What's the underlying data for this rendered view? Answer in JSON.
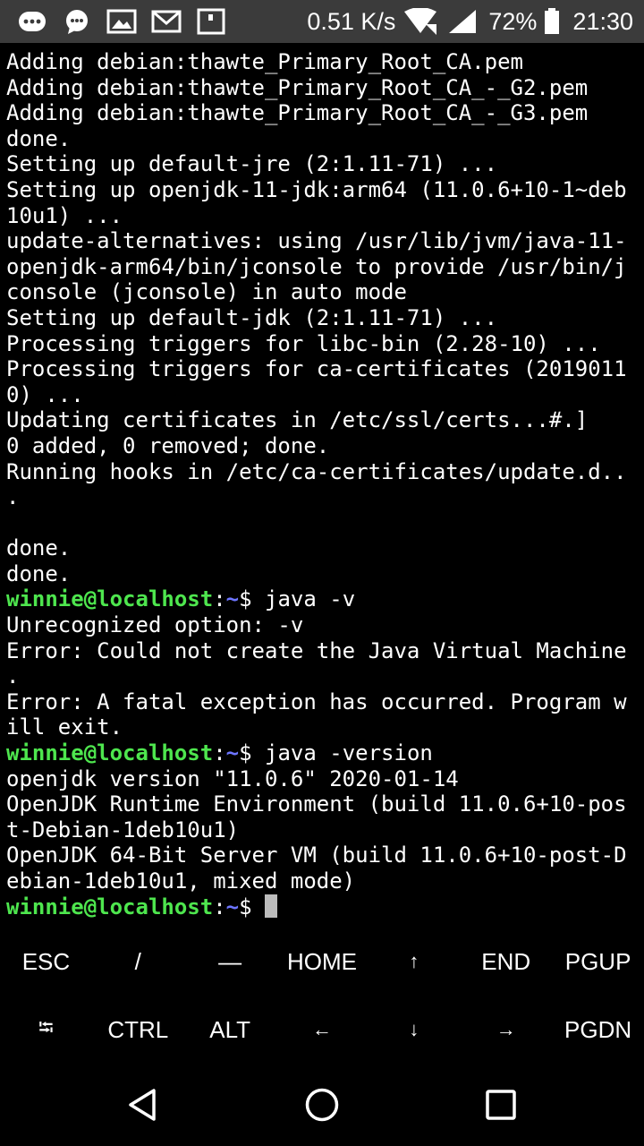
{
  "status_bar": {
    "icons": [
      "chat-bubble-icon",
      "whatsapp-icon",
      "gallery-icon",
      "gmail-icon",
      "notification-icon"
    ],
    "speed": "0.51 K/s",
    "battery": "72%",
    "time": "21:30"
  },
  "terminal": {
    "lines": [
      "Adding debian:thawte_Primary_Root_CA.pem",
      "Adding debian:thawte_Primary_Root_CA_-_G2.pem",
      "Adding debian:thawte_Primary_Root_CA_-_G3.pem",
      "done.",
      "Setting up default-jre (2:1.11-71) ...",
      "Setting up openjdk-11-jdk:arm64 (11.0.6+10-1~deb",
      "10u1) ...",
      "update-alternatives: using /usr/lib/jvm/java-11-",
      "openjdk-arm64/bin/jconsole to provide /usr/bin/j",
      "console (jconsole) in auto mode",
      "Setting up default-jdk (2:1.11-71) ...",
      "Processing triggers for libc-bin (2.28-10) ...",
      "Processing triggers for ca-certificates (2019011",
      "0) ...",
      "Updating certificates in /etc/ssl/certs...#.]",
      "0 added, 0 removed; done.",
      "Running hooks in /etc/ca-certificates/update.d..",
      ".",
      "",
      "done.",
      "done."
    ],
    "prompt_user": "winnie@localhost",
    "prompt_colon": ":",
    "prompt_path": "~",
    "prompt_symbol": "$ ",
    "command1": "java -v",
    "output1": [
      "Unrecognized option: -v",
      "Error: Could not create the Java Virtual Machine",
      ".",
      "Error: A fatal exception has occurred. Program w",
      "ill exit."
    ],
    "command2": "java -version",
    "output2": [
      "openjdk version \"11.0.6\" 2020-01-14",
      "OpenJDK Runtime Environment (build 11.0.6+10-pos",
      "t-Debian-1deb10u1)",
      "OpenJDK 64-Bit Server VM (build 11.0.6+10-post-D",
      "ebian-1deb10u1, mixed mode)"
    ]
  },
  "extra_keys": {
    "row1": [
      "ESC",
      "/",
      "—",
      "HOME",
      "↑",
      "END",
      "PGUP"
    ],
    "row2": [
      "⭾",
      "CTRL",
      "ALT",
      "←",
      "↓",
      "→",
      "PGDN"
    ]
  },
  "navigation": {
    "icons": [
      "back-icon",
      "home-icon",
      "recents-icon"
    ]
  },
  "colors": {
    "status_bar_bg": "#3b3b3b",
    "prompt_user": "#4ee64e",
    "prompt_path": "#6d75ff"
  }
}
